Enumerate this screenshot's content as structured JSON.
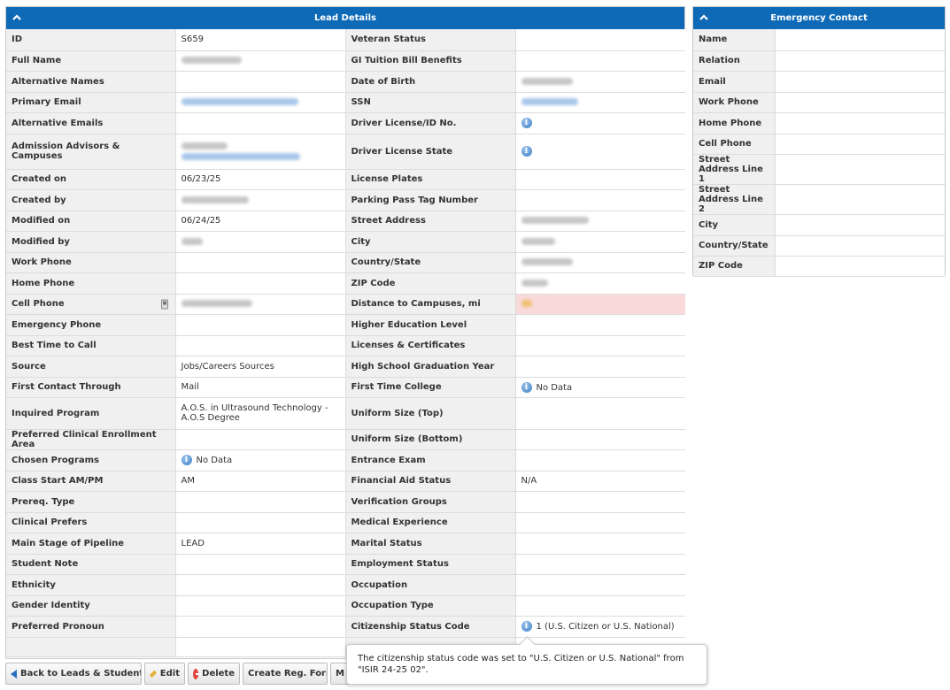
{
  "lead_panel": {
    "title": "Lead Details",
    "rows": [
      {
        "l1": "ID",
        "v1": "S659",
        "l2": "Veteran Status",
        "v2": ""
      },
      {
        "l1": "Full Name",
        "v1": "",
        "l2": "GI Tuition Bill Benefits",
        "v2": ""
      },
      {
        "l1": "Alternative Names",
        "v1": "",
        "l2": "Date of Birth",
        "v2": ""
      },
      {
        "l1": "Primary Email",
        "v1": "",
        "l2": "SSN",
        "v2": ""
      },
      {
        "l1": "Alternative Emails",
        "v1": "",
        "l2": "Driver License/ID No.",
        "v2": ""
      },
      {
        "l1": "Admission Advisors & Campuses",
        "v1": "",
        "l2": "Driver License State",
        "v2": ""
      },
      {
        "l1": "Created on",
        "v1": "06/23/25",
        "l2": "License Plates",
        "v2": ""
      },
      {
        "l1": "Created by",
        "v1": "",
        "l2": "Parking Pass Tag Number",
        "v2": ""
      },
      {
        "l1": "Modified on",
        "v1": "06/24/25",
        "l2": "Street Address",
        "v2": ""
      },
      {
        "l1": "Modified by",
        "v1": "",
        "l2": "City",
        "v2": ""
      },
      {
        "l1": "Work Phone",
        "v1": "",
        "l2": "Country/State",
        "v2": ""
      },
      {
        "l1": "Home Phone",
        "v1": "",
        "l2": "ZIP Code",
        "v2": ""
      },
      {
        "l1": "Cell Phone",
        "v1": "",
        "l2": "Distance to Campuses, mi",
        "v2": ""
      },
      {
        "l1": "Emergency Phone",
        "v1": "",
        "l2": "Higher Education Level",
        "v2": ""
      },
      {
        "l1": "Best Time to Call",
        "v1": "",
        "l2": "Licenses & Certificates",
        "v2": ""
      },
      {
        "l1": "Source",
        "v1": "Jobs/Careers Sources",
        "l2": "High School Graduation Year",
        "v2": ""
      },
      {
        "l1": "First Contact Through",
        "v1": "Mail",
        "l2": "First Time College",
        "v2": "No Data"
      },
      {
        "l1": "Inquired Program",
        "v1": "A.O.S. in Ultrasound Technology - A.O.S Degree",
        "l2": "Uniform Size (Top)",
        "v2": ""
      },
      {
        "l1": "Preferred Clinical Enrollment Area",
        "v1": "",
        "l2": "Uniform Size (Bottom)",
        "v2": ""
      },
      {
        "l1": "Chosen Programs",
        "v1": "No Data",
        "l2": "Entrance Exam",
        "v2": ""
      },
      {
        "l1": "Class Start AM/PM",
        "v1": "AM",
        "l2": "Financial Aid Status",
        "v2": "N/A"
      },
      {
        "l1": "Prereq. Type",
        "v1": "",
        "l2": "Verification Groups",
        "v2": ""
      },
      {
        "l1": "Clinical Prefers",
        "v1": "",
        "l2": "Medical Experience",
        "v2": ""
      },
      {
        "l1": "Main Stage of Pipeline",
        "v1": "LEAD",
        "l2": "Marital Status",
        "v2": ""
      },
      {
        "l1": "Student Note",
        "v1": "",
        "l2": "Employment Status",
        "v2": ""
      },
      {
        "l1": "Ethnicity",
        "v1": "",
        "l2": "Occupation",
        "v2": ""
      },
      {
        "l1": "Gender Identity",
        "v1": "",
        "l2": "Occupation Type",
        "v2": ""
      },
      {
        "l1": "Preferred Pronoun",
        "v1": "",
        "l2": "Citizenship Status Code",
        "v2": "1 (U.S. Citizen or U.S. National)"
      }
    ]
  },
  "emergency_panel": {
    "title": "Emergency Contact",
    "labels": [
      "Name",
      "Relation",
      "Email",
      "Work Phone",
      "Home Phone",
      "Cell Phone",
      "Street Address Line 1",
      "Street Address Line 2",
      "City",
      "Country/State",
      "ZIP Code"
    ]
  },
  "buttons": {
    "back": "Back to Leads & Students",
    "edit": "Edit",
    "delete": "Delete",
    "create_reg": "Create Reg. Form",
    "more": "M"
  },
  "tooltip": {
    "text": "The citizenship status code was set to \"U.S. Citizen or U.S. National\" from \"ISIR 24-25 02\"."
  },
  "icons": {
    "collapse": "chevron-up-icon",
    "info": "info-icon",
    "phone": "mobile-phone-icon",
    "back": "arrow-left-icon",
    "edit": "pencil-icon",
    "delete": "delete-icon"
  },
  "colors": {
    "header_blue": "#0e6ab6",
    "label_bg": "#f0f0f0",
    "highlight_pink": "#f9d9d9"
  }
}
